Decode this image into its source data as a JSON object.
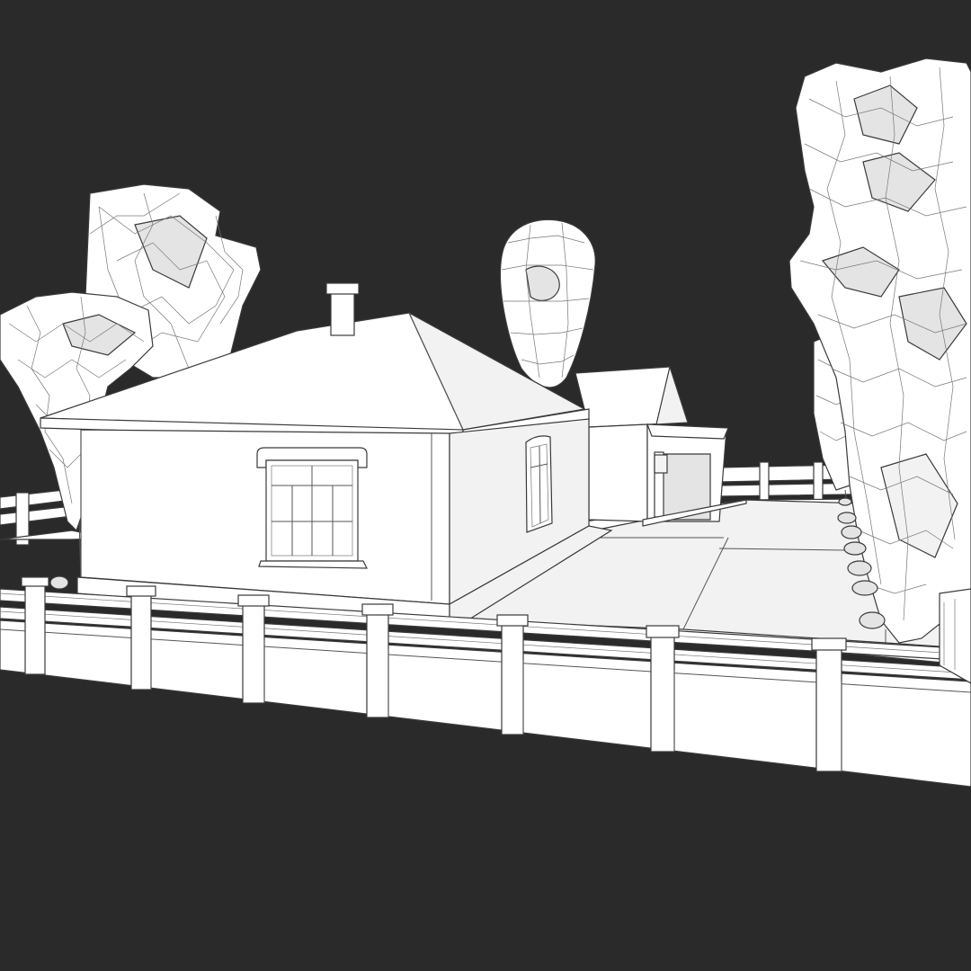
{
  "scene": {
    "background_color": "#2a2a2a",
    "model_color": "#ffffff",
    "wire_color": "#3a3a3a",
    "render_style": "wireframe-on-shaded",
    "objects": [
      "house",
      "garage-extension",
      "trees",
      "fence",
      "shrubs",
      "yard"
    ]
  }
}
